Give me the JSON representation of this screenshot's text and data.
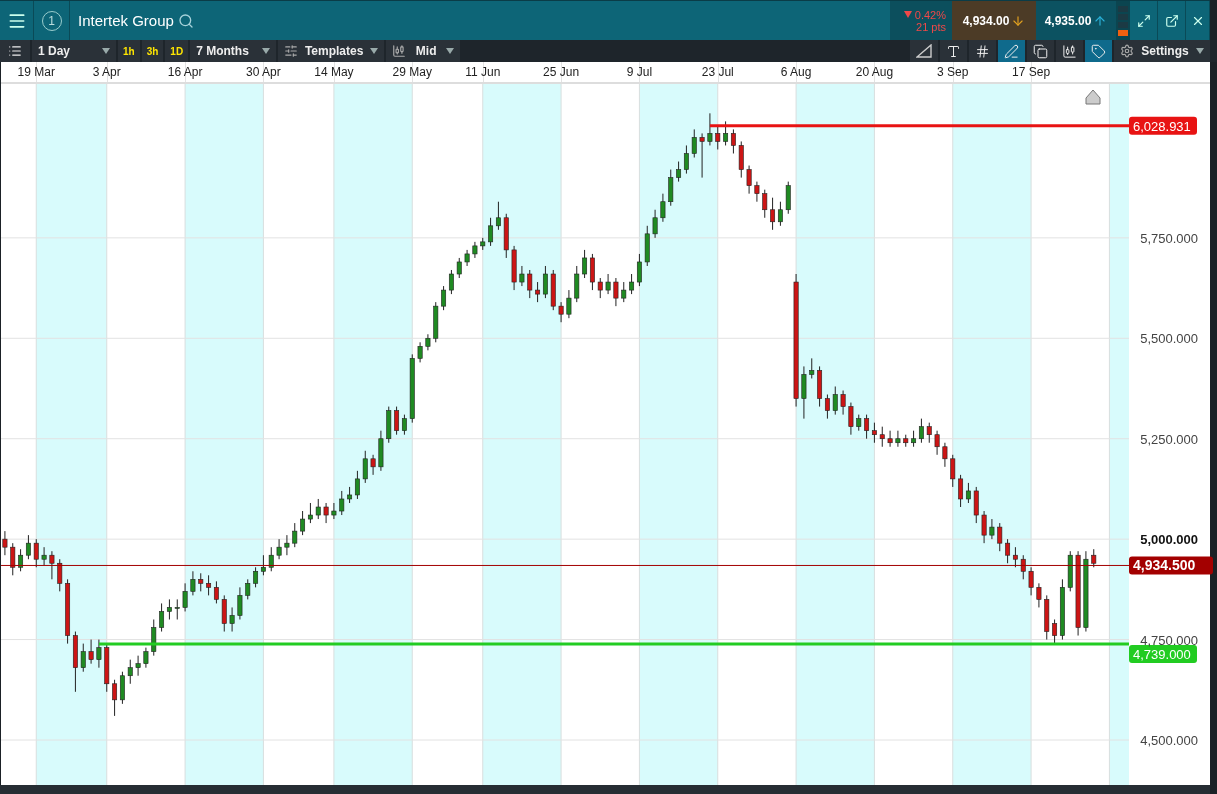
{
  "header": {
    "instance": "1",
    "title": "Intertek Group",
    "change_pct": "0.42%",
    "change_pts": "21 pts",
    "sell": "4,934.00",
    "buy": "4,935.00"
  },
  "toolbar": {
    "interval": "1 Day",
    "quick": [
      "1h",
      "3h",
      "1D"
    ],
    "range": "7 Months",
    "templates": "Templates",
    "price_type": "Mid",
    "tools": [
      {
        "selected": false
      },
      {
        "selected": false
      },
      {
        "selected": false
      },
      {
        "selected": true
      },
      {
        "selected": false
      },
      {
        "selected": false
      },
      {
        "selected": true
      }
    ],
    "settings": "Settings"
  },
  "chart": {
    "price_label_styles": [
      {
        "bold": false
      },
      {
        "bold": false
      },
      {
        "bold": false
      },
      {
        "bold": true
      },
      {
        "bold": false
      },
      {
        "bold": false
      }
    ],
    "chart_data": {
      "type": "candlestick",
      "categories": [
        null,
        null,
        null,
        null,
        "19 Mar",
        null,
        null,
        null,
        null,
        null,
        null,
        null,
        null,
        "3 Apr",
        null,
        null,
        null,
        null,
        null,
        null,
        null,
        null,
        null,
        "16 Apr",
        null,
        null,
        null,
        null,
        null,
        null,
        null,
        null,
        null,
        "30 Apr",
        null,
        null,
        null,
        null,
        null,
        null,
        null,
        null,
        "14 May",
        null,
        null,
        null,
        null,
        null,
        null,
        null,
        null,
        null,
        "29 May",
        null,
        null,
        null,
        null,
        null,
        null,
        null,
        null,
        "11 Jun",
        null,
        null,
        null,
        null,
        null,
        null,
        null,
        null,
        null,
        "25 Jun",
        null,
        null,
        null,
        null,
        null,
        null,
        null,
        null,
        null,
        "9 Jul",
        null,
        null,
        null,
        null,
        null,
        null,
        null,
        null,
        null,
        "23 Jul",
        null,
        null,
        null,
        null,
        null,
        null,
        null,
        null,
        null,
        "6 Aug",
        null,
        null,
        null,
        null,
        null,
        null,
        null,
        null,
        null,
        "20 Aug",
        null,
        null,
        null,
        null,
        null,
        null,
        null,
        null,
        null,
        "3 Sep",
        null,
        null,
        null,
        null,
        null,
        null,
        null,
        null,
        null,
        "17 Sep",
        null,
        null,
        null,
        null,
        null,
        null,
        null,
        null,
        null,
        null,
        null,
        null
      ],
      "ylim": [
        4388,
        6133
      ],
      "yticks": [
        {
          "value": 5750,
          "label": "5,750.000"
        },
        {
          "value": 5500,
          "label": "5,500.000"
        },
        {
          "value": 5250,
          "label": "5,250.000"
        },
        {
          "value": 5000,
          "label": "5,000.000"
        },
        {
          "value": 4750,
          "label": "4,750.000"
        },
        {
          "value": 4500,
          "label": "4,500.000"
        }
      ],
      "grid": true,
      "ref_lines": [
        {
          "axis": "y",
          "value": 6028.931,
          "label": "6,028.931",
          "color": "#e81313"
        },
        {
          "axis": "y",
          "value": 4934.5,
          "label": "4,934.500",
          "color": "#a30000"
        },
        {
          "axis": "y",
          "value": 4739,
          "label": "4,739.000",
          "color": "#22cc22"
        }
      ],
      "ohlc": [
        [
          5000,
          5020,
          4960,
          4980
        ],
        [
          4980,
          4990,
          4910,
          4930
        ],
        [
          4930,
          4975,
          4920,
          4960
        ],
        [
          4960,
          5010,
          4950,
          4990
        ],
        [
          4990,
          5000,
          4930,
          4950
        ],
        [
          4950,
          4980,
          4935,
          4960
        ],
        [
          4960,
          4970,
          4900,
          4940
        ],
        [
          4940,
          4950,
          4870,
          4890
        ],
        [
          4890,
          4900,
          4740,
          4760
        ],
        [
          4760,
          4770,
          4620,
          4680
        ],
        [
          4680,
          4740,
          4670,
          4720
        ],
        [
          4720,
          4750,
          4690,
          4700
        ],
        [
          4700,
          4750,
          4680,
          4730
        ],
        [
          4730,
          4740,
          4620,
          4640
        ],
        [
          4640,
          4650,
          4560,
          4600
        ],
        [
          4600,
          4670,
          4590,
          4660
        ],
        [
          4660,
          4700,
          4640,
          4680
        ],
        [
          4680,
          4710,
          4660,
          4690
        ],
        [
          4690,
          4730,
          4680,
          4720
        ],
        [
          4720,
          4800,
          4710,
          4780
        ],
        [
          4780,
          4840,
          4770,
          4820
        ],
        [
          4820,
          4850,
          4800,
          4830
        ],
        [
          4830,
          4850,
          4800,
          4830
        ],
        [
          4830,
          4890,
          4820,
          4870
        ],
        [
          4870,
          4920,
          4860,
          4900
        ],
        [
          4900,
          4915,
          4870,
          4890
        ],
        [
          4890,
          4910,
          4860,
          4880
        ],
        [
          4880,
          4895,
          4840,
          4850
        ],
        [
          4850,
          4860,
          4770,
          4790
        ],
        [
          4790,
          4830,
          4770,
          4810
        ],
        [
          4810,
          4880,
          4800,
          4860
        ],
        [
          4860,
          4900,
          4850,
          4890
        ],
        [
          4890,
          4930,
          4880,
          4920
        ],
        [
          4920,
          4960,
          4910,
          4930
        ],
        [
          4930,
          4980,
          4920,
          4960
        ],
        [
          4960,
          5000,
          4950,
          4980
        ],
        [
          4980,
          5010,
          4960,
          4990
        ],
        [
          4990,
          5040,
          4980,
          5020
        ],
        [
          5020,
          5070,
          5010,
          5050
        ],
        [
          5050,
          5090,
          5040,
          5060
        ],
        [
          5060,
          5100,
          5050,
          5080
        ],
        [
          5080,
          5090,
          5040,
          5060
        ],
        [
          5060,
          5090,
          5050,
          5070
        ],
        [
          5070,
          5120,
          5060,
          5100
        ],
        [
          5100,
          5130,
          5090,
          5110
        ],
        [
          5110,
          5170,
          5100,
          5150
        ],
        [
          5150,
          5220,
          5140,
          5200
        ],
        [
          5200,
          5210,
          5160,
          5180
        ],
        [
          5180,
          5270,
          5170,
          5250
        ],
        [
          5250,
          5330,
          5240,
          5320
        ],
        [
          5320,
          5330,
          5260,
          5270
        ],
        [
          5270,
          5310,
          5260,
          5300
        ],
        [
          5300,
          5460,
          5290,
          5450
        ],
        [
          5450,
          5490,
          5440,
          5480
        ],
        [
          5480,
          5510,
          5470,
          5500
        ],
        [
          5500,
          5590,
          5490,
          5580
        ],
        [
          5580,
          5630,
          5570,
          5620
        ],
        [
          5620,
          5670,
          5610,
          5660
        ],
        [
          5660,
          5700,
          5650,
          5690
        ],
        [
          5690,
          5720,
          5680,
          5710
        ],
        [
          5710,
          5740,
          5700,
          5730
        ],
        [
          5730,
          5750,
          5720,
          5740
        ],
        [
          5740,
          5800,
          5730,
          5780
        ],
        [
          5780,
          5840,
          5770,
          5800
        ],
        [
          5800,
          5810,
          5700,
          5720
        ],
        [
          5720,
          5730,
          5620,
          5640
        ],
        [
          5640,
          5680,
          5630,
          5660
        ],
        [
          5660,
          5670,
          5600,
          5620
        ],
        [
          5620,
          5640,
          5590,
          5610
        ],
        [
          5610,
          5680,
          5600,
          5660
        ],
        [
          5660,
          5670,
          5570,
          5580
        ],
        [
          5580,
          5590,
          5540,
          5560
        ],
        [
          5560,
          5620,
          5550,
          5600
        ],
        [
          5600,
          5680,
          5590,
          5660
        ],
        [
          5660,
          5720,
          5650,
          5700
        ],
        [
          5700,
          5710,
          5620,
          5640
        ],
        [
          5640,
          5650,
          5600,
          5620
        ],
        [
          5620,
          5660,
          5610,
          5640
        ],
        [
          5640,
          5650,
          5580,
          5600
        ],
        [
          5600,
          5640,
          5590,
          5620
        ],
        [
          5620,
          5660,
          5610,
          5640
        ],
        [
          5640,
          5710,
          5630,
          5690
        ],
        [
          5690,
          5780,
          5680,
          5760
        ],
        [
          5760,
          5820,
          5750,
          5800
        ],
        [
          5800,
          5860,
          5790,
          5840
        ],
        [
          5840,
          5920,
          5830,
          5900
        ],
        [
          5900,
          5940,
          5890,
          5920
        ],
        [
          5920,
          5980,
          5910,
          5960
        ],
        [
          5960,
          6020,
          5950,
          6000
        ],
        [
          6000,
          6010,
          5900,
          5990
        ],
        [
          5990,
          6060,
          5980,
          6010
        ],
        [
          6010,
          6030,
          5970,
          5990
        ],
        [
          5990,
          6040,
          5980,
          6010
        ],
        [
          6010,
          6020,
          5960,
          5980
        ],
        [
          5980,
          5990,
          5900,
          5920
        ],
        [
          5920,
          5930,
          5860,
          5880
        ],
        [
          5880,
          5890,
          5840,
          5860
        ],
        [
          5860,
          5870,
          5800,
          5820
        ],
        [
          5820,
          5850,
          5770,
          5790
        ],
        [
          5790,
          5840,
          5780,
          5820
        ],
        [
          5820,
          5890,
          5810,
          5880
        ],
        [
          5640,
          5660,
          5330,
          5350
        ],
        [
          5350,
          5430,
          5300,
          5410
        ],
        [
          5410,
          5450,
          5400,
          5420
        ],
        [
          5420,
          5430,
          5330,
          5350
        ],
        [
          5350,
          5360,
          5300,
          5320
        ],
        [
          5320,
          5380,
          5310,
          5360
        ],
        [
          5360,
          5370,
          5310,
          5330
        ],
        [
          5330,
          5340,
          5260,
          5280
        ],
        [
          5280,
          5310,
          5270,
          5300
        ],
        [
          5300,
          5310,
          5250,
          5270
        ],
        [
          5270,
          5290,
          5240,
          5260
        ],
        [
          5260,
          5280,
          5230,
          5250
        ],
        [
          5250,
          5270,
          5230,
          5240
        ],
        [
          5240,
          5270,
          5230,
          5250
        ],
        [
          5250,
          5260,
          5230,
          5240
        ],
        [
          5240,
          5270,
          5230,
          5250
        ],
        [
          5250,
          5300,
          5240,
          5280
        ],
        [
          5280,
          5290,
          5240,
          5260
        ],
        [
          5260,
          5270,
          5210,
          5230
        ],
        [
          5230,
          5240,
          5180,
          5200
        ],
        [
          5200,
          5210,
          5130,
          5150
        ],
        [
          5150,
          5160,
          5080,
          5100
        ],
        [
          5100,
          5140,
          5090,
          5120
        ],
        [
          5120,
          5130,
          5040,
          5060
        ],
        [
          5060,
          5070,
          4990,
          5010
        ],
        [
          5010,
          5050,
          5000,
          5030
        ],
        [
          5030,
          5040,
          4970,
          4990
        ],
        [
          4990,
          5000,
          4940,
          4960
        ],
        [
          4960,
          4980,
          4930,
          4950
        ],
        [
          4950,
          4960,
          4900,
          4920
        ],
        [
          4920,
          4930,
          4860,
          4880
        ],
        [
          4880,
          4890,
          4830,
          4850
        ],
        [
          4850,
          4860,
          4750,
          4770
        ],
        [
          4790,
          4800,
          4740,
          4760
        ],
        [
          4760,
          4900,
          4750,
          4880
        ],
        [
          4880,
          4970,
          4870,
          4960
        ],
        [
          4960,
          4970,
          4760,
          4780
        ],
        [
          4780,
          4970,
          4770,
          4950
        ],
        [
          4960,
          4975,
          4930,
          4940
        ],
        null,
        null,
        null,
        null
      ]
    }
  }
}
